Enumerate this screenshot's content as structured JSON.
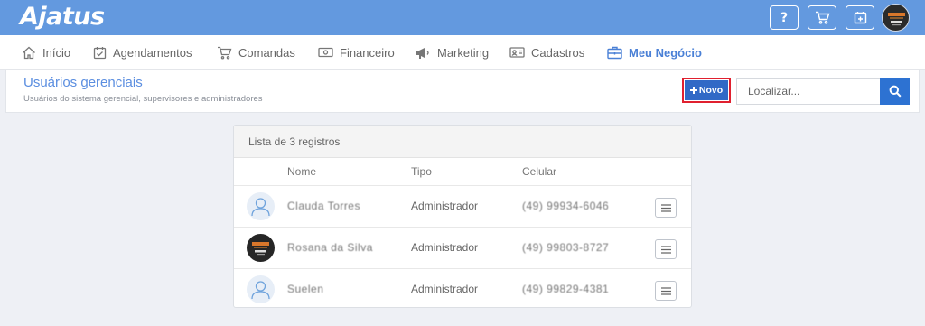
{
  "app": {
    "logo_text": "Ajatus"
  },
  "topbar": {
    "help_label": "?",
    "icons": [
      "help-icon",
      "cart-icon",
      "calendar-icon"
    ],
    "avatar_brand": "ROSANA"
  },
  "nav": {
    "items": [
      {
        "label": "Início",
        "icon": "home-icon"
      },
      {
        "label": "Agendamentos",
        "icon": "calendar-check-icon"
      },
      {
        "label": "Comandas",
        "icon": "cart-icon"
      },
      {
        "label": "Financeiro",
        "icon": "money-icon"
      },
      {
        "label": "Marketing",
        "icon": "megaphone-icon"
      },
      {
        "label": "Cadastros",
        "icon": "id-card-icon"
      },
      {
        "label": "Meu Negócio",
        "icon": "briefcase-icon",
        "active": true
      }
    ]
  },
  "header": {
    "title": "Usuários gerenciais",
    "subtitle": "Usuários do sistema gerencial, supervisores e administradores",
    "new_button_label": "Novo",
    "search_placeholder": "Localizar..."
  },
  "list": {
    "caption": "Lista de 3 registros",
    "columns": {
      "name": "Nome",
      "type": "Tipo",
      "phone": "Celular"
    },
    "rows": [
      {
        "name": "Clauda Torres",
        "type": "Administrador",
        "phone": "(49) 99934-6046",
        "avatar": "default"
      },
      {
        "name": "Rosana da Silva",
        "type": "Administrador",
        "phone": "(49) 99803-8727",
        "avatar": "brand"
      },
      {
        "name": "Suelen",
        "type": "Administrador",
        "phone": "(49) 99829-4381",
        "avatar": "default"
      }
    ]
  },
  "colors": {
    "topbar": "#6399df",
    "accent": "#4a80d6",
    "primary_button": "#3169c6",
    "highlight_border": "#e0202f"
  }
}
